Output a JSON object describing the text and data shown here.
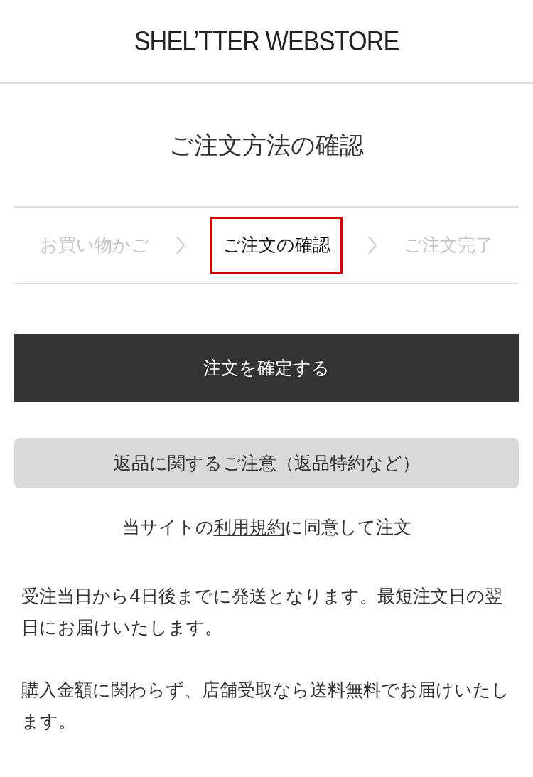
{
  "header": {
    "logo": "SHEL’TTER WEBSTORE"
  },
  "page_title": "ご注文方法の確認",
  "steps": [
    {
      "label": "お買い物かご",
      "selected": false
    },
    {
      "label": "ご注文の確認",
      "selected": true
    },
    {
      "label": "ご注文完了",
      "selected": false
    }
  ],
  "confirm_button": "注文を確定する",
  "returns_button": "返品に関するご注意（返品特約など）",
  "agreement": {
    "before": "当サイトの",
    "link": "利用規約",
    "after": "に同意して注文"
  },
  "notes": [
    "受注当日から4日後までに発送となります。最短注文日の翌日にお届けいたします。",
    "購入金額に関わらず、店舗受取なら送料無料でお届けいたします。"
  ]
}
